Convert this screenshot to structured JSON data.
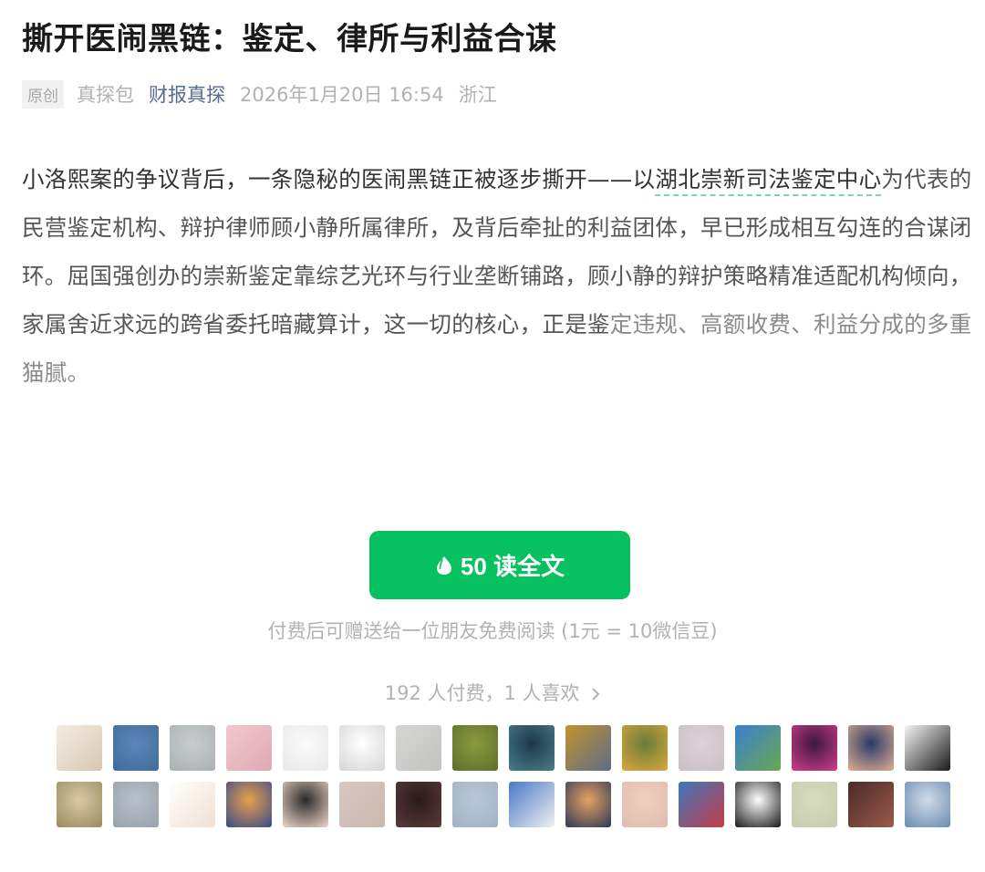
{
  "article": {
    "title": "撕开医闹黑链：鉴定、律所与利益合谋",
    "badge": "原创",
    "author": "真探包",
    "account": "财报真探",
    "date": "2026年1月20日 16:54",
    "location": "浙江",
    "body": {
      "part1": "小洛熙案的争议背后，一条隐秘的医闹黑链正被逐步撕开——以",
      "link": "湖北崇新司法鉴定中心",
      "part2": "为代表的民营鉴定机构、辩护律师顾小静所属律所，及背后牵扯的利益团体，早已形成相互勾连的合谋闭环。屈国强创办的崇新鉴定靠综艺光环与行业垄断铺路，顾小静的辩护策略精准适配机构倾向，家属舍近求远的跨省委托暗藏算计，这一切的核心，正是鉴",
      "part3": "定违规、高额收费、利益分成的多重猫腻。"
    }
  },
  "paywall": {
    "button_label": "50 读全文",
    "button_icon": "wechat-bean-icon",
    "gift_note": "付费后可赠送给一位朋友免费阅读 (1元 = 10微信豆)",
    "payers_summary": "192 人付费，1 人喜欢",
    "accent_color": "#07c160",
    "link_color": "#576b95"
  },
  "avatars": [
    {
      "name": "avatar-1",
      "colors": [
        "#f3ece4",
        "#d9c7b0"
      ]
    },
    {
      "name": "avatar-2",
      "colors": [
        "#5d86b8",
        "#3c6c9a"
      ]
    },
    {
      "name": "avatar-3",
      "colors": [
        "#c9ccd0",
        "#aab1b2"
      ]
    },
    {
      "name": "avatar-4",
      "colors": [
        "#f1c9cf",
        "#e0a8b2"
      ]
    },
    {
      "name": "avatar-5",
      "colors": [
        "#fbfbfb",
        "#e8e8e8"
      ]
    },
    {
      "name": "avatar-6",
      "colors": [
        "#ffffff",
        "#d6d6d6"
      ]
    },
    {
      "name": "avatar-7",
      "colors": [
        "#d6d6d4",
        "#c2c2c0"
      ]
    },
    {
      "name": "avatar-8",
      "colors": [
        "#8c9a3f",
        "#5b6f2d"
      ]
    },
    {
      "name": "avatar-9",
      "colors": [
        "#1d3848",
        "#4a7d8c"
      ]
    },
    {
      "name": "avatar-10",
      "colors": [
        "#c4922c",
        "#5b6d8a"
      ]
    },
    {
      "name": "avatar-11",
      "colors": [
        "#6a7b3a",
        "#d9a93d"
      ]
    },
    {
      "name": "avatar-12",
      "colors": [
        "#ddd2d8",
        "#cbbfc6"
      ]
    },
    {
      "name": "avatar-13",
      "colors": [
        "#3a7fd0",
        "#6aa84f"
      ]
    },
    {
      "name": "avatar-14",
      "colors": [
        "#3a1a3c",
        "#d23c8c"
      ]
    },
    {
      "name": "avatar-15",
      "colors": [
        "#2a3a6a",
        "#e0b090"
      ]
    },
    {
      "name": "avatar-16",
      "colors": [
        "#f5f5f5",
        "#1a1a1a"
      ]
    },
    {
      "name": "avatar-17",
      "colors": [
        "#d9c9a8",
        "#9a8a5a"
      ]
    },
    {
      "name": "avatar-18",
      "colors": [
        "#b8c0c8",
        "#98a2ad"
      ]
    },
    {
      "name": "avatar-19",
      "colors": [
        "#ffffff",
        "#f0e0d0"
      ]
    },
    {
      "name": "avatar-20",
      "colors": [
        "#e6a04a",
        "#3a4a8a"
      ]
    },
    {
      "name": "avatar-21",
      "colors": [
        "#2a2a2a",
        "#f0d8c8"
      ]
    },
    {
      "name": "avatar-22",
      "colors": [
        "#d8c8c0",
        "#c8b8ae"
      ]
    },
    {
      "name": "avatar-23",
      "colors": [
        "#2a1a1a",
        "#5a3a3a"
      ]
    },
    {
      "name": "avatar-24",
      "colors": [
        "#b8c6d8",
        "#a2b2c6"
      ]
    },
    {
      "name": "avatar-25",
      "colors": [
        "#4a78c8",
        "#f0f0f0"
      ]
    },
    {
      "name": "avatar-26",
      "colors": [
        "#e8a060",
        "#2a3a5a"
      ]
    },
    {
      "name": "avatar-27",
      "colors": [
        "#f0d0c0",
        "#e0bcae"
      ]
    },
    {
      "name": "avatar-28",
      "colors": [
        "#3a7ab8",
        "#c83a4a"
      ]
    },
    {
      "name": "avatar-29",
      "colors": [
        "#ffffff",
        "#1a1a1a"
      ]
    },
    {
      "name": "avatar-30",
      "colors": [
        "#d8dcc0",
        "#c8ccae"
      ]
    },
    {
      "name": "avatar-31",
      "colors": [
        "#4a2a2a",
        "#9a5a4a"
      ]
    },
    {
      "name": "avatar-32",
      "colors": [
        "#d0dce8",
        "#6a8ab0"
      ]
    }
  ]
}
